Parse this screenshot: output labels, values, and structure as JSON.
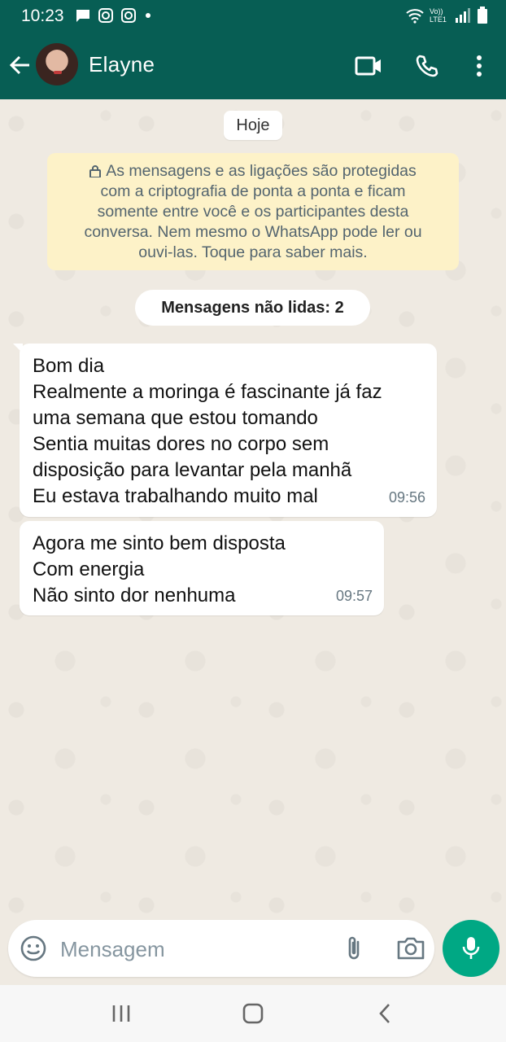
{
  "status_bar": {
    "time": "10:23",
    "network_label": "Vo)) LTE1"
  },
  "header": {
    "contact_name": "Elayne"
  },
  "chat": {
    "date_chip": "Hoje",
    "encryption_notice": "As mensagens e as ligações são protegidas com a criptografia de ponta a ponta e ficam somente entre você e os participantes desta conversa. Nem mesmo o WhatsApp pode ler ou ouvi-las. Toque para saber mais.",
    "encryption_lines": [
      "As mensagens e as ligações são protegidas",
      "com a criptografia de ponta a ponta e ficam",
      "somente entre você e os participantes desta",
      "conversa. Nem mesmo o WhatsApp pode ler ou",
      "ouvi-las. Toque para saber mais."
    ],
    "unread_label": "Mensagens não lidas: 2",
    "messages": [
      {
        "lines": [
          "Bom dia",
          "Realmente a moringa é  fascinante já  faz",
          "uma semana que  estou  tomando",
          "Sentia muitas dores no corpo sem",
          "disposição para levantar pela manhã",
          "Eu estava trabalhando muito  mal"
        ],
        "time": "09:56"
      },
      {
        "lines": [
          "Agora me sinto  bem disposta",
          "Com energia",
          "Não  sinto dor nenhuma"
        ],
        "time": "09:57"
      }
    ]
  },
  "composer": {
    "placeholder": "Mensagem"
  },
  "icons": {
    "back": "arrow-left-icon",
    "video": "video-call-icon",
    "call": "phone-icon",
    "menu": "more-vert-icon",
    "emoji": "emoji-icon",
    "attach": "paperclip-icon",
    "camera": "camera-icon",
    "mic": "microphone-icon"
  },
  "colors": {
    "header": "#075e54",
    "accent": "#00a884",
    "chat_bg": "#efeae2",
    "notice_bg": "#fdf2c8"
  }
}
